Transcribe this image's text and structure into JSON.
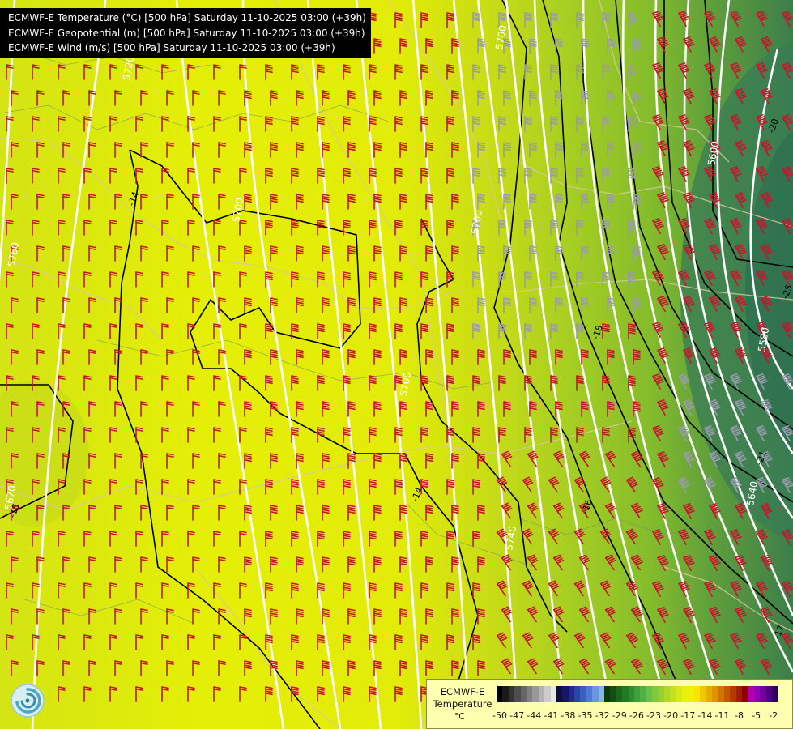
{
  "header": {
    "lines": [
      "ECMWF-E Temperature (°C) [500 hPa] Saturday 11-10-2025 03:00 (+39h)",
      "ECMWF-E Geopotential (m) [500 hPa] Saturday 11-10-2025 03:00 (+39h)",
      "ECMWF-E Wind (m/s) [500 hPa] Saturday 11-10-2025 03:00 (+39h)"
    ]
  },
  "scale": {
    "model": "ECMWF-E",
    "variable": "Temperature",
    "unit": "°C",
    "colors": [
      "#000000",
      "#1a1a1a",
      "#333333",
      "#4d4d4d",
      "#666666",
      "#808080",
      "#999999",
      "#b3b3b3",
      "#cccccc",
      "#e6e6e6",
      "#0d0d40",
      "#15156a",
      "#1f2a8c",
      "#2a44a8",
      "#3a5fc0",
      "#5078d4",
      "#6a95e0",
      "#88b2ec",
      "#0a3a0a",
      "#125012",
      "#1a661a",
      "#227a22",
      "#2e8c2e",
      "#3aa03a",
      "#50b040",
      "#68c048",
      "#80c83c",
      "#98d030",
      "#b0d828",
      "#c4e020",
      "#d8e818",
      "#e8f010",
      "#f0f000",
      "#f4e400",
      "#f0c800",
      "#e8ac00",
      "#e09000",
      "#d07400",
      "#c05800",
      "#b03c00",
      "#a01e00",
      "#8c0000",
      "#b000b0",
      "#9000c0",
      "#7000a0",
      "#500080",
      "#30005c"
    ],
    "ticks": [
      "-50",
      "-47",
      "-44",
      "-41",
      "-38",
      "-35",
      "-32",
      "-29",
      "-26",
      "-23",
      "-20",
      "-17",
      "-14",
      "-11",
      "-8",
      "-5",
      "-2"
    ]
  },
  "contours": {
    "geopotential_labels": [
      "5700",
      "5700",
      "5600",
      "5580",
      "5700",
      "5640",
      "5740",
      "5760",
      "5720",
      "5700",
      "5670"
    ],
    "temperature_labels": [
      "-14",
      "-16",
      "-18",
      "-21",
      "-25",
      "-14",
      "-15",
      "-17",
      "-20"
    ]
  },
  "colors": {
    "warm": "#e6ec0c",
    "mid": "#b4d41c",
    "cold": "#3c8a4a",
    "barb_warm": "#c8142c",
    "barb_cold": "#9a9ab0",
    "iso_height": "#ffffff",
    "iso_temp": "#000000"
  }
}
